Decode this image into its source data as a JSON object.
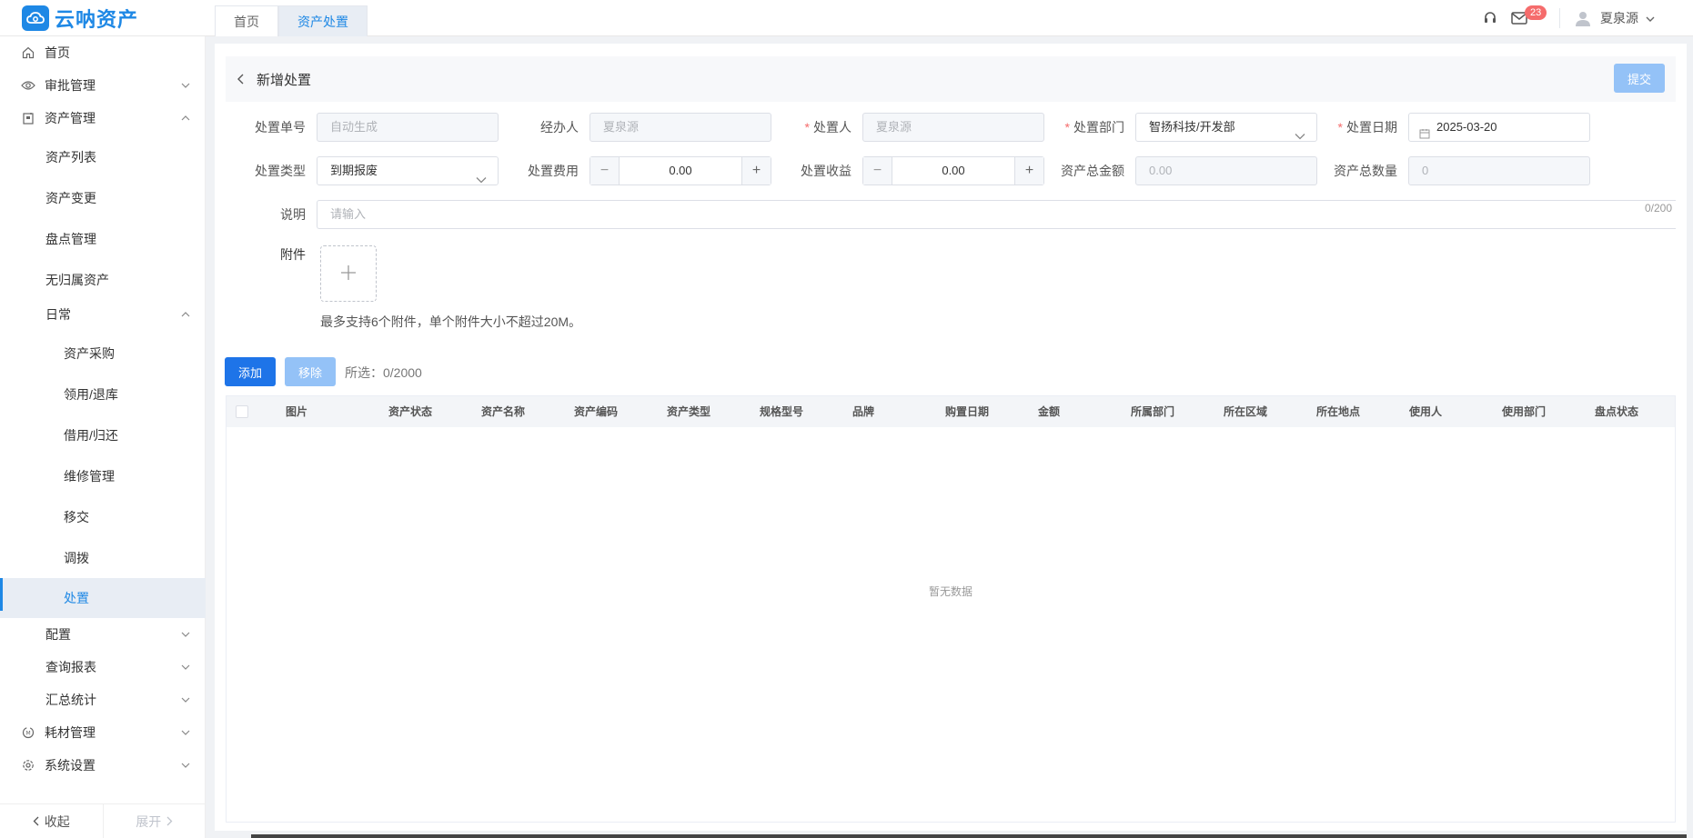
{
  "app": {
    "name": "云呐资产",
    "brand_color": "#1e88e5",
    "logo_icon": "cloud-icon"
  },
  "tabs": [
    {
      "label": "首页",
      "active": false
    },
    {
      "label": "资产处置",
      "active": true
    }
  ],
  "header_right": {
    "support_icon": "headset-icon",
    "mail_icon": "mail-icon",
    "notification_count": "23",
    "user_name": "夏泉源"
  },
  "sidebar": {
    "items": [
      {
        "label": "首页",
        "icon": "home-icon",
        "level": 0
      },
      {
        "label": "审批管理",
        "icon": "eye-icon",
        "level": 0,
        "chevron": "down"
      },
      {
        "label": "资产管理",
        "icon": "asset-icon",
        "level": 0,
        "chevron": "up"
      },
      {
        "label": "资产列表",
        "level": 1
      },
      {
        "label": "资产变更",
        "level": 1
      },
      {
        "label": "盘点管理",
        "level": 1
      },
      {
        "label": "无归属资产",
        "level": 1
      },
      {
        "label": "日常",
        "level": 1,
        "chevron": "up"
      },
      {
        "label": "资产采购",
        "level": 2
      },
      {
        "label": "领用/退库",
        "level": 2
      },
      {
        "label": "借用/归还",
        "level": 2
      },
      {
        "label": "维修管理",
        "level": 2
      },
      {
        "label": "移交",
        "level": 2
      },
      {
        "label": "调拨",
        "level": 2
      },
      {
        "label": "处置",
        "level": 2,
        "active": true
      },
      {
        "label": "配置",
        "level": 1,
        "chevron": "down"
      },
      {
        "label": "查询报表",
        "level": 1,
        "chevron": "down"
      },
      {
        "label": "汇总统计",
        "level": 1,
        "chevron": "down"
      },
      {
        "label": "耗材管理",
        "icon": "consumable-icon",
        "level": 0,
        "chevron": "down"
      },
      {
        "label": "系统设置",
        "icon": "gear-icon",
        "level": 0,
        "chevron": "down"
      }
    ],
    "collapse_label": "收起",
    "expand_label": "展开"
  },
  "page": {
    "title": "新增处置",
    "submit_label": "提交"
  },
  "form": {
    "order_no": {
      "label": "处置单号",
      "placeholder": "自动生成"
    },
    "handler": {
      "label": "经办人",
      "value": "夏泉源"
    },
    "disposer": {
      "label": "处置人",
      "value": "夏泉源",
      "required": true
    },
    "department": {
      "label": "处置部门",
      "value": "智扬科技/开发部",
      "required": true
    },
    "date": {
      "label": "处置日期",
      "value": "2025-03-20",
      "required": true
    },
    "type": {
      "label": "处置类型",
      "value": "到期报废"
    },
    "cost": {
      "label": "处置费用",
      "value": "0.00"
    },
    "income": {
      "label": "处置收益",
      "value": "0.00"
    },
    "total_amount": {
      "label": "资产总金额",
      "value": "0.00"
    },
    "total_qty": {
      "label": "资产总数量",
      "value": "0"
    },
    "remark": {
      "label": "说明",
      "placeholder": "请输入",
      "counter": "0/200"
    },
    "attachment": {
      "label": "附件",
      "hint": "最多支持6个附件，单个附件大小不超过20M。"
    }
  },
  "table_toolbar": {
    "add_label": "添加",
    "remove_label": "移除",
    "selected_text": "所选：0/2000"
  },
  "table": {
    "columns": [
      "图片",
      "资产状态",
      "资产名称",
      "资产编码",
      "资产类型",
      "规格型号",
      "品牌",
      "购置日期",
      "金额",
      "所属部门",
      "所在区域",
      "所在地点",
      "使用人",
      "使用部门",
      "盘点状态"
    ],
    "empty_text": "暂无数据"
  }
}
